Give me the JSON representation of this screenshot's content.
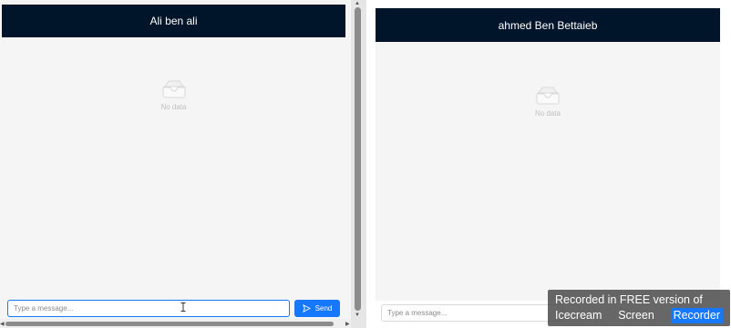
{
  "left_chat": {
    "header_title": "Ali ben ali",
    "empty_text": "No data",
    "input_placeholder": "Type a message...",
    "send_label": "Send"
  },
  "right_chat": {
    "header_title": "ahmed Ben Bettaieb",
    "empty_text": "No data",
    "input_placeholder": "Type a message..."
  },
  "watermark": {
    "line1": "Recorded in FREE version of",
    "line2_a": "Icecream",
    "line2_b": "Screen",
    "line2_c": "Recorder"
  },
  "colors": {
    "header_bg": "#001529",
    "accent": "#1677ff",
    "chat_bg": "#f5f5f5"
  },
  "icons": {
    "empty_state": "inbox-icon",
    "send": "send-icon"
  }
}
